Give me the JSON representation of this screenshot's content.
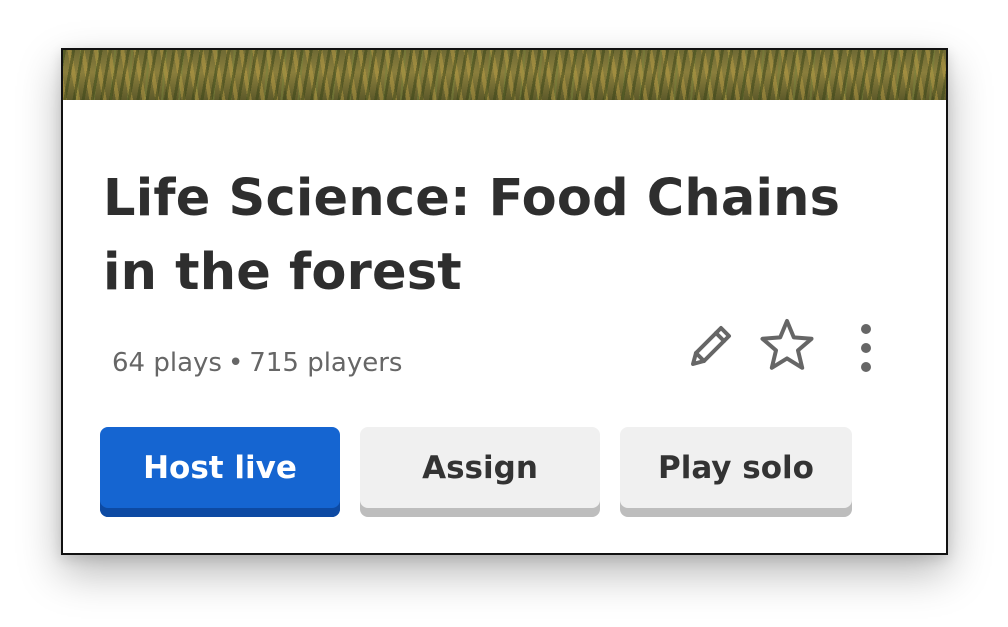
{
  "card": {
    "cover_image": "forest-cover-image",
    "title": "Life Science: Food Chains in the forest",
    "stats": {
      "plays": "64 plays",
      "separator": "•",
      "players": "715 players"
    },
    "icons": {
      "edit": "pencil-icon",
      "favorite": "star-icon",
      "more": "more-vertical-icon"
    },
    "buttons": {
      "host_live": "Host live",
      "assign": "Assign",
      "play_solo": "Play solo"
    }
  },
  "colors": {
    "primary": "#1565d1",
    "primary_shadow": "#0d4aa3",
    "secondary": "#f0f0f0",
    "text_dark": "#2e2e2e",
    "text_muted": "#666666"
  }
}
